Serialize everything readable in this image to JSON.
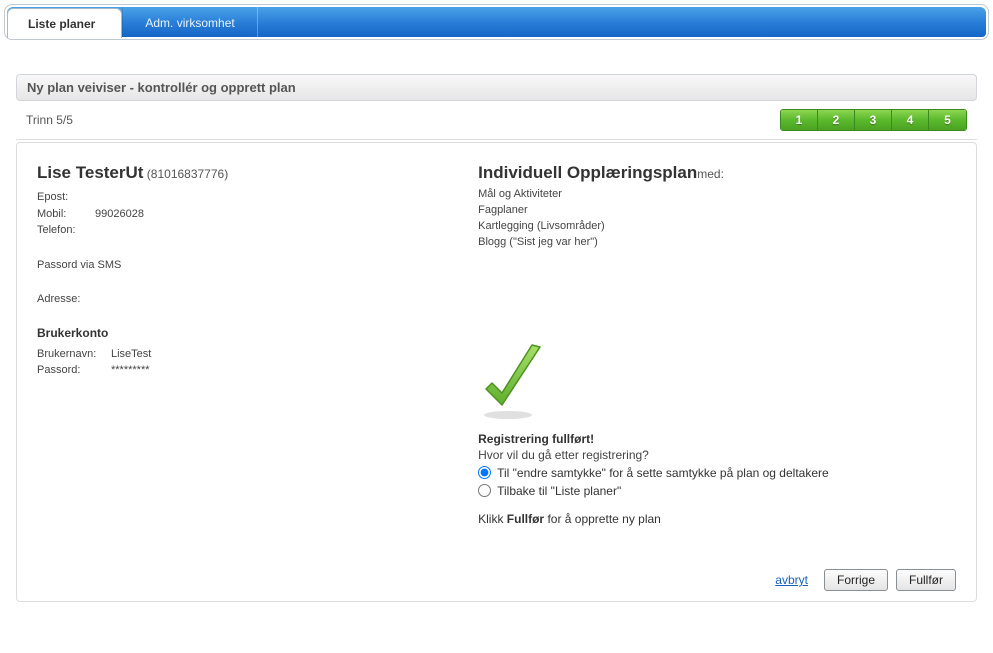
{
  "tabs": {
    "active": "Liste planer",
    "inactive": "Adm. virksomhet"
  },
  "wizard": {
    "title": "Ny plan veiviser - kontrollér og opprett plan",
    "step_label": "Trinn 5/5",
    "steps": [
      "1",
      "2",
      "3",
      "4",
      "5"
    ]
  },
  "person": {
    "name": "Lise TesterUt",
    "id": "(81016837776)",
    "labels": {
      "email": "Epost:",
      "mobile": "Mobil:",
      "phone": "Telefon:",
      "pwd_sms": "Passord via SMS",
      "address": "Adresse:",
      "account": "Brukerkonto",
      "username": "Brukernavn:",
      "password": "Passord:"
    },
    "email": "",
    "mobile": "99026028",
    "phone": "",
    "address": "",
    "username": "LiseTest",
    "password": "*********"
  },
  "plan": {
    "title": "Individuell Opplæringsplan",
    "suffix": "med:",
    "items": [
      "Mål og Aktiviteter",
      "Fagplaner",
      "Kartlegging (Livsområder)",
      "Blogg (\"Sist jeg var her\")"
    ]
  },
  "registration": {
    "heading": "Registrering fullført!",
    "question": "Hvor vil du gå etter registrering?",
    "option1": "Til \"endre samtykke\" for å sette samtykke på plan og deltakere",
    "option2": "Tilbake til \"Liste planer\"",
    "final_pre": "Klikk ",
    "final_bold": "Fullfør",
    "final_post": " for å opprette ny plan"
  },
  "buttons": {
    "cancel": "avbryt",
    "prev": "Forrige",
    "finish": "Fullfør"
  }
}
